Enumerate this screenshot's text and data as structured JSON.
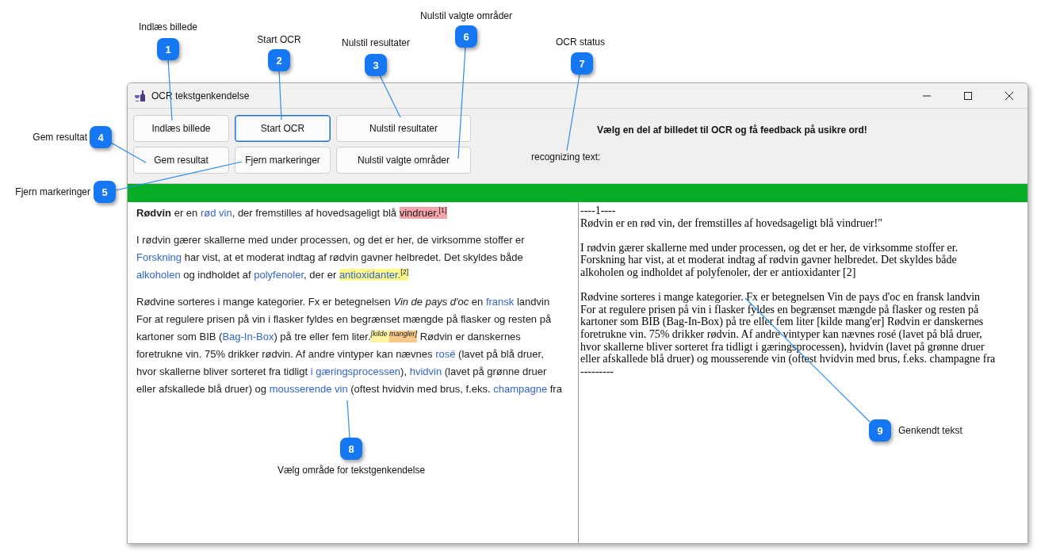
{
  "window": {
    "title": "OCR tekstgenkendelse"
  },
  "buttons": [
    {
      "label": "Indlæs billede",
      "focused": false
    },
    {
      "label": "Start OCR",
      "focused": true
    },
    {
      "label": "Nulstil resultater",
      "focused": false
    },
    {
      "label": "Gem resultat",
      "focused": false
    },
    {
      "label": "Fjern markeringer",
      "focused": false
    },
    {
      "label": "Nulstil valgte områder",
      "focused": false
    }
  ],
  "instruction": "Vælg en del af billedet til OCR og få feedback på usikre ord!",
  "status": "recognizing text:",
  "progress": {
    "level": 1
  },
  "article": [
    [
      {
        "kind": "bold",
        "text": "Rødvin"
      },
      {
        "kind": "plain",
        "text": " er en "
      },
      {
        "kind": "link",
        "text": "rød vin"
      },
      {
        "kind": "plain",
        "text": ", der fremstilles af hovedsageligt blå "
      },
      {
        "kind": "plain",
        "text": "vindruer.",
        "color": "#f5a3ab"
      },
      {
        "kind": "sup",
        "text": "[1]",
        "color": "#f5a3ab"
      }
    ],
    [
      {
        "kind": "plain",
        "text": "I rødvin gærer skallerne med under processen, og det er her, de virksomme stoffer er "
      },
      {
        "kind": "link",
        "text": "Forskning"
      },
      {
        "kind": "plain",
        "text": " har vist, at et moderat indtag af rødvin gavner helbredet. Det skyldes både "
      },
      {
        "kind": "link",
        "text": "alkoholen"
      },
      {
        "kind": "plain",
        "text": " og indholdet af "
      },
      {
        "kind": "link",
        "text": "polyfenoler"
      },
      {
        "kind": "plain",
        "text": ", der er "
      },
      {
        "kind": "link",
        "text": "antioxidanter.",
        "color": "#fdf78a"
      },
      {
        "kind": "sup",
        "text": "[2]",
        "color": "#fdf78a"
      }
    ],
    [
      {
        "kind": "plain",
        "text": "Rødvine sorteres i mange kategorier. Fx er betegnelsen "
      },
      {
        "kind": "italic",
        "text": "Vin de pays d'oc"
      },
      {
        "kind": "plain",
        "text": " en "
      },
      {
        "kind": "link",
        "text": "fransk"
      },
      {
        "kind": "plain",
        "text": " landvin For at regulere prisen på vin i flasker fyldes en begrænset mængde på flasker og resten på kartoner som BIB ("
      },
      {
        "kind": "link",
        "text": "Bag-In-Box"
      },
      {
        "kind": "plain",
        "text": ") på tre eller fem liter."
      },
      {
        "kind": "sup-italic",
        "text": "[kilde ",
        "color": "#fdf3a0"
      },
      {
        "kind": "sup-italic",
        "text": "mangler]",
        "color": "#f7c98a"
      },
      {
        "kind": "plain",
        "text": " Rødvin er danskernes foretrukne vin. 75% drikker rødvin. Af andre vintyper kan nævnes "
      },
      {
        "kind": "link",
        "text": "rosé"
      },
      {
        "kind": "plain",
        "text": " (lavet på blå druer, hvor skallerne bliver sorteret fra tidligt "
      },
      {
        "kind": "link",
        "text": "i gæringsprocessen"
      },
      {
        "kind": "plain",
        "text": "), "
      },
      {
        "kind": "link",
        "text": "hvidvin"
      },
      {
        "kind": "plain",
        "text": " (lavet på grønne druer eller afskallede blå druer) og "
      },
      {
        "kind": "link",
        "text": "mousserende vin"
      },
      {
        "kind": "plain",
        "text": " (oftest hvidvin med brus, f.eks. "
      },
      {
        "kind": "link",
        "text": "champagne"
      },
      {
        "kind": "plain",
        "text": " fra"
      }
    ]
  ],
  "ocr_result": [
    [
      "----1----",
      "Rødvin er en rød vin, der fremstilles af hovedsageligt blå vindruer!\""
    ],
    [
      "I rødvin gærer skallerne med under processen, og det er her, de virksomme stoffer er.",
      "Forskning har vist, at et moderat indtag af rødvin gavner helbredet. Det skyldes både",
      "alkoholen og indholdet af polyfenoler, der er antioxidanter [2]"
    ],
    [
      "Rødvine sorteres i mange kategorier. Fx er betegnelsen Vin de pays d'oc en fransk landvin",
      "For at regulere prisen på vin i flasker fyldes en begrænset mængde på flasker og resten på",
      "kartoner som BIB (Bag-In-Box) på tre eller fem liter [kilde mang'er] Rødvin er danskernes",
      "foretrukne vin. 75% drikker rødvin. Af andre vintyper kan nævnes rosé (lavet på blå druer,",
      "hvor skallerne bliver sorteret fra tidligt i gæringsprocessen), hvidvin (lavet på grønne druer",
      "eller afskallede blå druer) og mousserende vin (oftest hvidvin med brus, f.eks. champagne fra",
      "---------"
    ]
  ],
  "callouts": [
    {
      "number": "1",
      "label": "Indlæs billede"
    },
    {
      "number": "2",
      "label": "Start OCR"
    },
    {
      "number": "3",
      "label": "Nulstil resultater"
    },
    {
      "number": "4",
      "label": "Gem resultat"
    },
    {
      "number": "5",
      "label": "Fjern markeringer"
    },
    {
      "number": "6",
      "label": "Nulstil valgte områder"
    },
    {
      "number": "7",
      "label": "OCR status"
    },
    {
      "number": "8",
      "label": "Vælg område for tekstgenkendelse"
    },
    {
      "number": "9",
      "label": "Genkendt tekst"
    }
  ]
}
